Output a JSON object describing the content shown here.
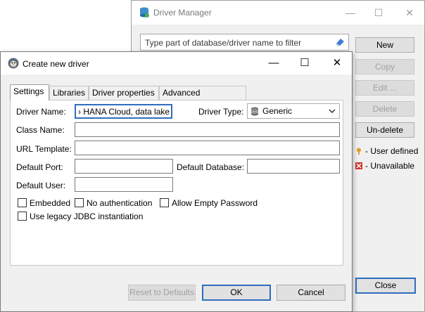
{
  "driver_manager": {
    "title": "Driver Manager",
    "filter_placeholder": "Type part of database/driver name to filter",
    "buttons": {
      "new": "New",
      "copy": "Copy",
      "edit": "Edit ...",
      "delete": "Delete",
      "undelete": "Un-delete",
      "close": "Close"
    },
    "legend": {
      "user_defined": "- User defined",
      "unavailable": "- Unavailable"
    },
    "window_controls": {
      "minimize": "—",
      "maximize": "☐",
      "close": "✕"
    }
  },
  "dialog": {
    "title": "Create new driver",
    "window_controls": {
      "minimize": "—",
      "maximize": "☐",
      "close": "✕"
    },
    "tabs": [
      "Settings",
      "Libraries",
      "Driver properties",
      "Advanced parameters"
    ],
    "labels": {
      "driver_name": "Driver Name:",
      "driver_type": "Driver Type:",
      "class_name": "Class Name:",
      "url_template": "URL Template:",
      "default_port": "Default Port:",
      "default_database": "Default Database:",
      "default_user": "Default User:"
    },
    "values": {
      "driver_name": "› HANA Cloud, data lake",
      "driver_type": "Generic",
      "class_name": "",
      "url_template": "",
      "default_port": "",
      "default_database": "",
      "default_user": ""
    },
    "checkboxes": {
      "embedded": "Embedded",
      "no_auth": "No authentication",
      "allow_empty": "Allow Empty Password",
      "legacy_jdbc": "Use legacy JDBC instantiation"
    },
    "buttons": {
      "reset": "Reset to Defaults",
      "ok": "OK",
      "cancel": "Cancel"
    }
  },
  "colors": {
    "accent": "#2f6dbf",
    "window_bg": "#f0f0f0",
    "disabled_text": "#a0a0a0"
  }
}
